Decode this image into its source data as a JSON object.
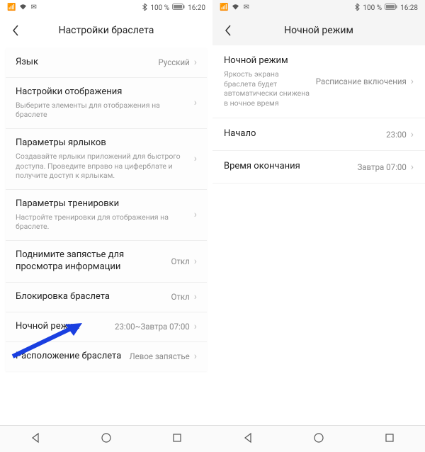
{
  "left": {
    "status": {
      "battery": "100 %",
      "time": "16:20"
    },
    "title": "Настройки браслета",
    "rows": [
      {
        "title": "Язык",
        "sub": "",
        "value": "Русский"
      },
      {
        "title": "Настройки отображения",
        "sub": "Выберите элементы для отображения на браслете",
        "value": ""
      },
      {
        "title": "Параметры ярлыков",
        "sub": "Создавайте ярлыки приложений для быстрого доступа. Проведите вправо на циферблате и получите доступ к ярлыкам.",
        "value": ""
      },
      {
        "title": "Параметры тренировки",
        "sub": "Настройте тренировки для отображения на браслете.",
        "value": ""
      },
      {
        "title": "Поднимите запястье для просмотра информации",
        "sub": "",
        "value": "Откл"
      },
      {
        "title": "Блокировка браслета",
        "sub": "",
        "value": "Откл"
      },
      {
        "title": "Ночной режим",
        "sub": "",
        "value": "23:00~Завтра 07:00"
      },
      {
        "title": "Расположение браслета",
        "sub": "",
        "value": "Левое запястье"
      }
    ]
  },
  "right": {
    "status": {
      "battery": "100 %",
      "time": "16:28"
    },
    "title": "Ночной режим",
    "rows": [
      {
        "title": "Ночной режим",
        "sub": "Яркость экрана браслета будет автоматически снижена в ночное время",
        "value": "Расписание включения"
      },
      {
        "title": "Начало",
        "sub": "",
        "value": "23:00"
      },
      {
        "title": "Время окончания",
        "sub": "",
        "value": "Завтра 07:00"
      }
    ]
  }
}
